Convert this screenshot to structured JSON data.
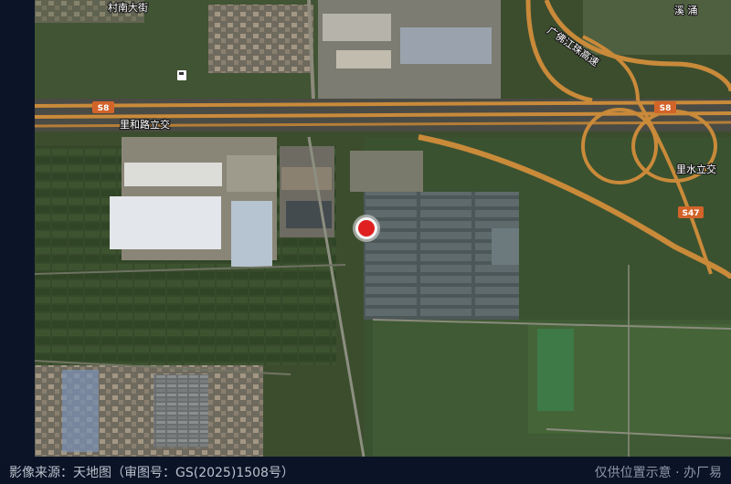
{
  "map": {
    "labels": {
      "village_street": "村南大街",
      "interchange_lihe": "里和路立交",
      "interchange_lishui": "里水立交",
      "expressway": "广佛江珠高速",
      "river": "溪 涌"
    },
    "shields": {
      "s8_left": "S8",
      "s8_right": "S8",
      "s47": "S47"
    },
    "marker": {
      "color": "#e02020",
      "icon": "location-pin-icon"
    },
    "poi": {
      "icon": "gas-station-icon"
    }
  },
  "footer": {
    "source": "影像来源：天地图（审图号：GS(2025)1508号）",
    "note": "仅供位置示意 · 办厂易"
  },
  "colors": {
    "road": "#c98a3a",
    "shield": "#d2642a",
    "footer_bg": "#0b1426"
  }
}
